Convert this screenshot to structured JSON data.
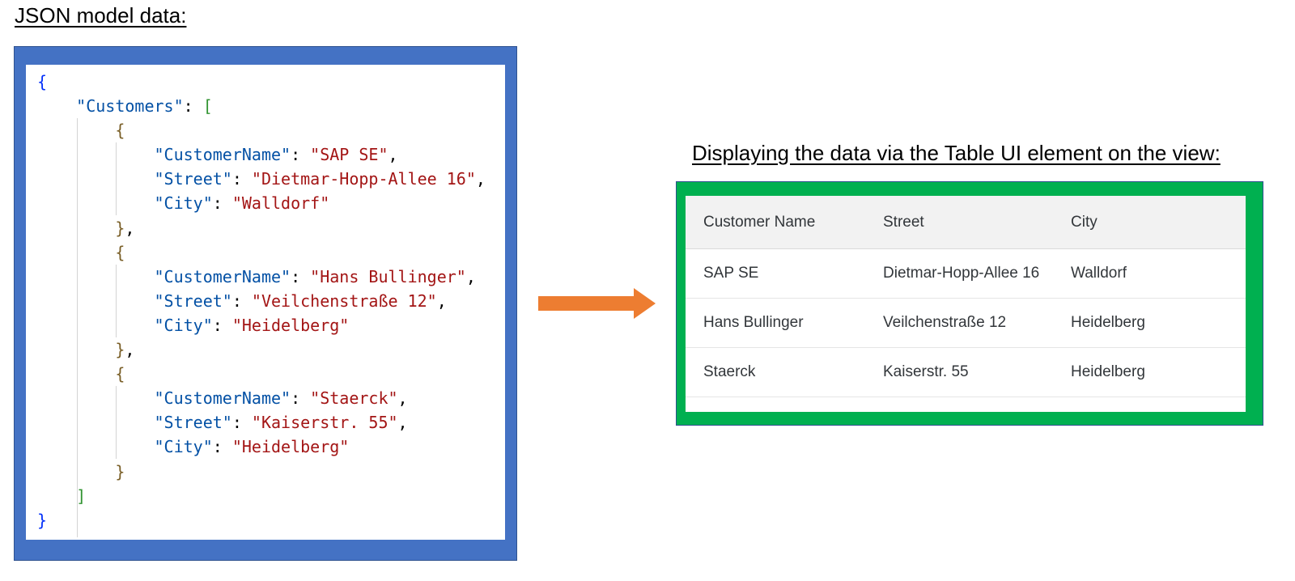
{
  "left_heading": "JSON model data:",
  "right_heading": "Displaying the data via the Table UI element on the view:",
  "json_code": {
    "lines": [
      [
        {
          "t": "{",
          "c": "brace"
        }
      ],
      [
        {
          "t": "    "
        },
        {
          "t": "\"Customers\"",
          "c": "key"
        },
        {
          "t": ": ",
          "c": "punct"
        },
        {
          "t": "[",
          "c": "bracket"
        }
      ],
      [
        {
          "t": "        "
        },
        {
          "t": "{",
          "c": "obj"
        }
      ],
      [
        {
          "t": "            "
        },
        {
          "t": "\"CustomerName\"",
          "c": "key"
        },
        {
          "t": ": ",
          "c": "punct"
        },
        {
          "t": "\"SAP SE\"",
          "c": "str"
        },
        {
          "t": ",",
          "c": "punct"
        }
      ],
      [
        {
          "t": "            "
        },
        {
          "t": "\"Street\"",
          "c": "key"
        },
        {
          "t": ": ",
          "c": "punct"
        },
        {
          "t": "\"Dietmar-Hopp-Allee 16\"",
          "c": "str"
        },
        {
          "t": ",",
          "c": "punct"
        }
      ],
      [
        {
          "t": "            "
        },
        {
          "t": "\"City\"",
          "c": "key"
        },
        {
          "t": ": ",
          "c": "punct"
        },
        {
          "t": "\"Walldorf\"",
          "c": "str"
        }
      ],
      [
        {
          "t": "        "
        },
        {
          "t": "}",
          "c": "obj"
        },
        {
          "t": ",",
          "c": "punct"
        }
      ],
      [
        {
          "t": "        "
        },
        {
          "t": "{",
          "c": "obj"
        }
      ],
      [
        {
          "t": "            "
        },
        {
          "t": "\"CustomerName\"",
          "c": "key"
        },
        {
          "t": ": ",
          "c": "punct"
        },
        {
          "t": "\"Hans Bullinger\"",
          "c": "str"
        },
        {
          "t": ",",
          "c": "punct"
        }
      ],
      [
        {
          "t": "            "
        },
        {
          "t": "\"Street\"",
          "c": "key"
        },
        {
          "t": ": ",
          "c": "punct"
        },
        {
          "t": "\"Veilchenstraße 12\"",
          "c": "str"
        },
        {
          "t": ",",
          "c": "punct"
        }
      ],
      [
        {
          "t": "            "
        },
        {
          "t": "\"City\"",
          "c": "key"
        },
        {
          "t": ": ",
          "c": "punct"
        },
        {
          "t": "\"Heidelberg\"",
          "c": "str"
        }
      ],
      [
        {
          "t": "        "
        },
        {
          "t": "}",
          "c": "obj"
        },
        {
          "t": ",",
          "c": "punct"
        }
      ],
      [
        {
          "t": "        "
        },
        {
          "t": "{",
          "c": "obj"
        }
      ],
      [
        {
          "t": "            "
        },
        {
          "t": "\"CustomerName\"",
          "c": "key"
        },
        {
          "t": ": ",
          "c": "punct"
        },
        {
          "t": "\"Staerck\"",
          "c": "str"
        },
        {
          "t": ",",
          "c": "punct"
        }
      ],
      [
        {
          "t": "            "
        },
        {
          "t": "\"Street\"",
          "c": "key"
        },
        {
          "t": ": ",
          "c": "punct"
        },
        {
          "t": "\"Kaiserstr. 55\"",
          "c": "str"
        },
        {
          "t": ",",
          "c": "punct"
        }
      ],
      [
        {
          "t": "            "
        },
        {
          "t": "\"City\"",
          "c": "key"
        },
        {
          "t": ": ",
          "c": "punct"
        },
        {
          "t": "\"Heidelberg\"",
          "c": "str"
        }
      ],
      [
        {
          "t": "        "
        },
        {
          "t": "}",
          "c": "obj"
        }
      ],
      [
        {
          "t": "    "
        },
        {
          "t": "]",
          "c": "bracket"
        }
      ],
      [
        {
          "t": "}",
          "c": "brace"
        }
      ]
    ]
  },
  "table": {
    "columns": [
      "Customer Name",
      "Street",
      "City"
    ],
    "rows": [
      [
        "SAP SE",
        "Dietmar-Hopp-Allee 16",
        "Walldorf"
      ],
      [
        "Hans Bullinger",
        "Veilchenstraße 12",
        "Heidelberg"
      ],
      [
        "Staerck",
        "Kaiserstr. 55",
        "Heidelberg"
      ]
    ]
  },
  "colors": {
    "code_frame": "#4472c4",
    "table_frame": "#00b050",
    "arrow": "#ed7d31"
  },
  "icons": {
    "arrow": "right-arrow-icon"
  }
}
